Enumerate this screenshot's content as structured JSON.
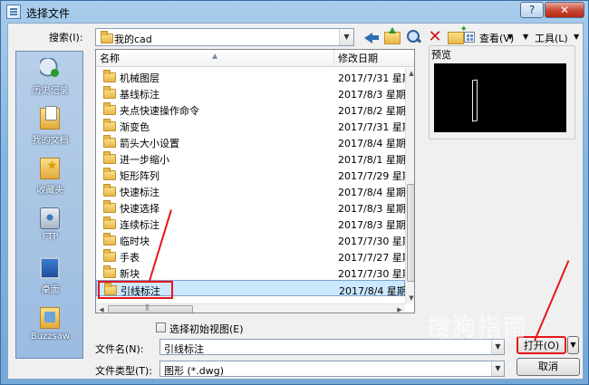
{
  "window": {
    "title": "选择文件",
    "help": "?",
    "close": "✕"
  },
  "search": {
    "label": "搜索(I):",
    "folder": "我的cad"
  },
  "toolbar": {
    "views_label": "查看(V)",
    "tools_label": "工具(L)"
  },
  "places": [
    {
      "label": "历史记录",
      "icon": "history-icon"
    },
    {
      "label": "我的文档",
      "icon": "documents-icon"
    },
    {
      "label": "收藏夹",
      "icon": "favorites-icon"
    },
    {
      "label": "FTP",
      "icon": "ftp-icon"
    },
    {
      "label": "桌面",
      "icon": "desktop-icon"
    },
    {
      "label": "Buzzsaw",
      "icon": "buzzsaw-icon"
    }
  ],
  "filelist": {
    "columns": [
      "名称",
      "修改日期"
    ],
    "rows": [
      {
        "name": "机械图层",
        "date": "2017/7/31 星期"
      },
      {
        "name": "基线标注",
        "date": "2017/8/3 星期"
      },
      {
        "name": "夹点快速操作命令",
        "date": "2017/8/2 星期"
      },
      {
        "name": "渐变色",
        "date": "2017/7/31 星期"
      },
      {
        "name": "箭头大小设置",
        "date": "2017/8/4 星期"
      },
      {
        "name": "进一步缩小",
        "date": "2017/8/1 星期"
      },
      {
        "name": "矩形阵列",
        "date": "2017/7/29 星期"
      },
      {
        "name": "快速标注",
        "date": "2017/8/4 星期"
      },
      {
        "name": "快速选择",
        "date": "2017/8/3 星期"
      },
      {
        "name": "连续标注",
        "date": "2017/8/3 星期"
      },
      {
        "name": "临时块",
        "date": "2017/7/30 星期"
      },
      {
        "name": "手表",
        "date": "2017/7/27 星期"
      },
      {
        "name": "新块",
        "date": "2017/7/30 星期"
      },
      {
        "name": "引线标注",
        "date": "2017/8/4 星期"
      }
    ],
    "selected_index": 13
  },
  "preview": {
    "label": "预览"
  },
  "initial_view": {
    "label": "选择初始视图(E)",
    "checked": false
  },
  "filename": {
    "label": "文件名(N):",
    "value": "引线标注"
  },
  "filetype": {
    "label": "文件类型(T):",
    "value": "图形 (*.dwg)"
  },
  "buttons": {
    "open": "打开(O)",
    "cancel": "取消"
  },
  "watermark": {
    "text": "搜狗指南",
    "sub": "zhinan.sogou.com"
  },
  "colors": {
    "annotation": "#e8141b",
    "selection": "#cce8ff"
  }
}
